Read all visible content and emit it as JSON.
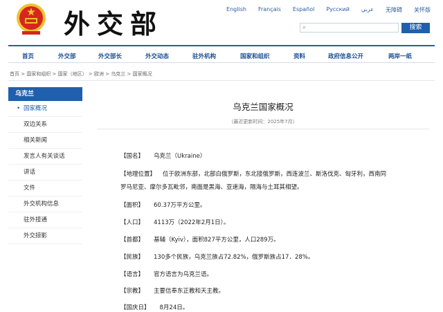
{
  "header": {
    "languages": [
      "English",
      "Français",
      "Español",
      "Русский",
      "عربي",
      "无障碍",
      "关怀版"
    ],
    "logo_text": "外交部",
    "search_placeholder": "",
    "search_button": "搜索"
  },
  "nav": {
    "items": [
      "首页",
      "外交部",
      "外交部长",
      "外交动态",
      "驻外机构",
      "国家和组织",
      "资料",
      "政府信息公开",
      "两岸一纸"
    ]
  },
  "breadcrumb": [
    "首页",
    "国家和组织",
    "国家（地区）",
    "欧洲",
    "乌克兰",
    "国家概况"
  ],
  "sidebar": {
    "header": "乌克兰",
    "items": [
      "国家概况",
      "双边关系",
      "相关新闻",
      "发言人有关谈话",
      "讲话",
      "文件",
      "外交机构信息",
      "驻外接通",
      "外交掠影"
    ]
  },
  "article": {
    "title": "乌克兰国家概况",
    "updated": "（最近更新时间：2025年7月）",
    "rows": [
      {
        "label": "【国名】",
        "text": "乌克兰（Ukraine）"
      },
      {
        "label": "【地理位置】",
        "text": "位于欧洲东部，北部白俄罗斯，东北接俄罗斯，西连波兰、斯洛伐克、匈牙利，西南同",
        "cont": "罗马尼亚、摩尔多瓦毗邻，南面是黑海、亚速海，隔海与土耳其相望。"
      },
      {
        "label": "【面积】",
        "text": "60.37万平方公里。"
      },
      {
        "label": "【人口】",
        "text": "4113万（2022年2月1日）。"
      },
      {
        "label": "【首都】",
        "text": "基辅（Kyiv），面积827平方公里，人口289万。"
      },
      {
        "label": "【民族】",
        "text": "130多个民族，乌克兰族占72.82%，俄罗斯族占17．28%。"
      },
      {
        "label": "【语言】",
        "text": "官方语言为乌克兰语。"
      },
      {
        "label": "【宗教】",
        "text": "主要信奉东正教和天主教。"
      },
      {
        "label": "【国庆日】",
        "text": "8月24日。"
      }
    ]
  },
  "colors": {
    "accent": "#1f5fad",
    "emblem_red": "#d7261e",
    "emblem_gold": "#f2c230"
  }
}
